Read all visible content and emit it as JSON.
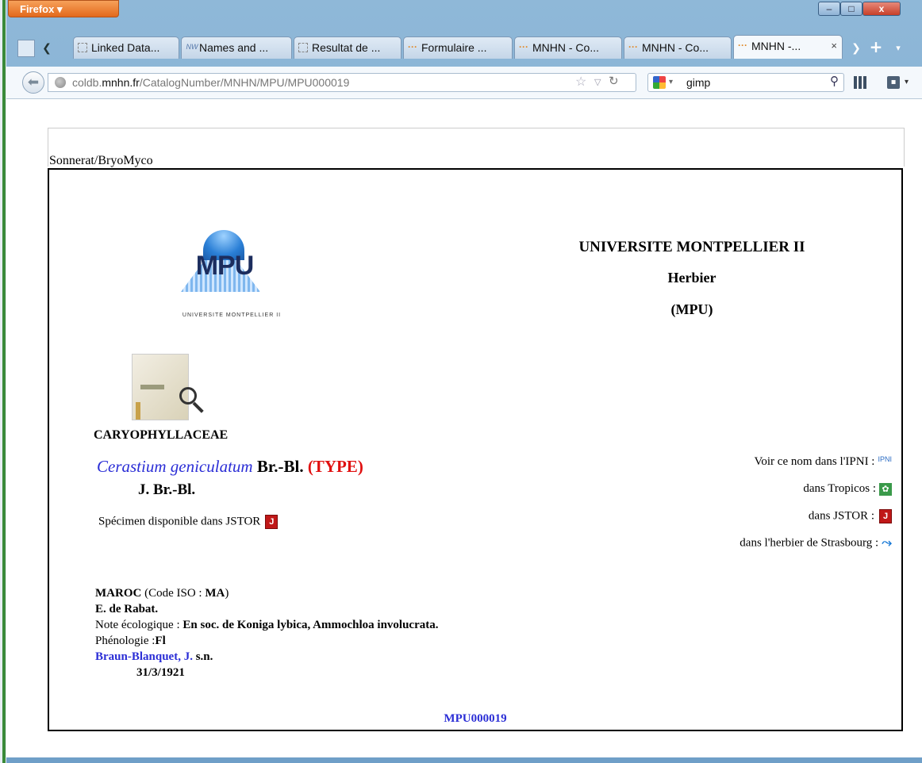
{
  "browser": {
    "menu_button": "Firefox",
    "window_controls": {
      "minimize": "–",
      "maximize": "□",
      "close": "x"
    },
    "tabs": [
      {
        "label": "Linked Data...",
        "icon": "page-icon",
        "active": false
      },
      {
        "label": "Names and ...",
        "icon": "nw-icon",
        "active": false
      },
      {
        "label": "Resultat de ...",
        "icon": "page-icon",
        "active": false
      },
      {
        "label": "Formulaire ...",
        "icon": "dots-icon",
        "active": false
      },
      {
        "label": "MNHN - Co...",
        "icon": "dots-icon",
        "active": false
      },
      {
        "label": "MNHN - Co...",
        "icon": "dots-icon",
        "active": false
      },
      {
        "label": "MNHN -...",
        "icon": "dots-icon",
        "active": true,
        "close": "×"
      }
    ],
    "new_tab_label": "+",
    "url": {
      "prefix": "coldb.",
      "host": "mnhn.fr",
      "path": "/CatalogNumber/MNHN/MPU/MPU000019"
    },
    "search_value": "gimp"
  },
  "page": {
    "collection_label": "Sonnerat/BryoMyco",
    "logo": {
      "text": "MPU",
      "subtitle": "UNIVERSITE MONTPELLIER II"
    },
    "institution": {
      "title": "UNIVERSITE MONTPELLIER II",
      "subtitle": "Herbier",
      "code": "(MPU)"
    },
    "family": "CARYOPHYLLACEAE",
    "taxon": {
      "name": "Cerastium geniculatum",
      "author": "Br.-Bl.",
      "type_status": "(TYPE)",
      "determiner": "J. Br.-Bl."
    },
    "jstor_available": "Spécimen disponible dans JSTOR",
    "external_links": {
      "ipni": "Voir ce nom dans l'IPNI :",
      "ipni_icon": "IPNI",
      "tropicos": "dans Tropicos :",
      "jstor": "dans JSTOR :",
      "strasbourg": "dans l'herbier de Strasbourg :"
    },
    "details": {
      "country": "MAROC",
      "iso_label": "(Code ISO :",
      "iso_code": "MA",
      "iso_close": ")",
      "locality": "E. de Rabat.",
      "ecology_label": "Note écologique :",
      "ecology_value": "En soc. de Koniga lybica, Ammochloa involucrata.",
      "phenology_label": "Phénologie :",
      "phenology_value": "Fl",
      "collector": "Braun-Blanquet",
      "collector_initial": ", J.",
      "collector_number": "s.n.",
      "date": "31/3/1921"
    },
    "catalog_number": "MPU000019"
  }
}
